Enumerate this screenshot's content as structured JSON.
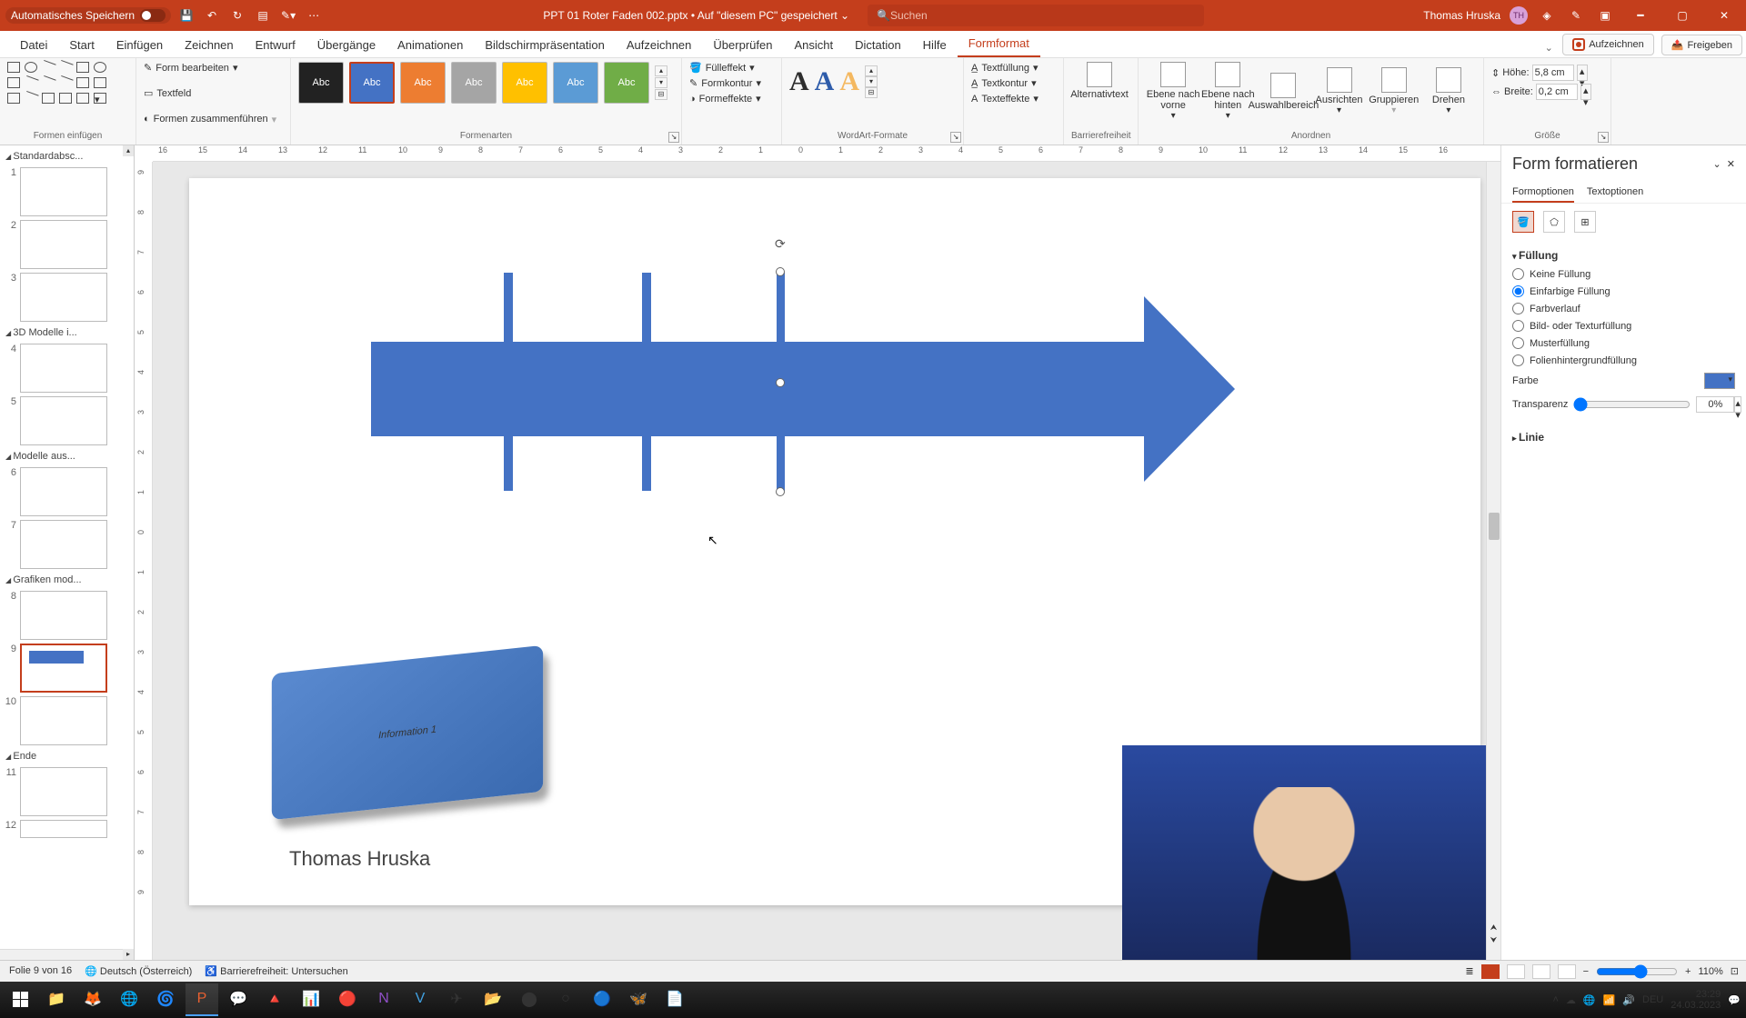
{
  "titlebar": {
    "autosave": "Automatisches Speichern",
    "doc": "PPT 01 Roter Faden 002.pptx • Auf \"diesem PC\" gespeichert ⌄",
    "search_ph": "Suchen",
    "user": "Thomas Hruska",
    "initials": "TH"
  },
  "tabs": {
    "file": "Datei",
    "start": "Start",
    "insert": "Einfügen",
    "draw": "Zeichnen",
    "design": "Entwurf",
    "trans": "Übergänge",
    "anim": "Animationen",
    "show": "Bildschirmpräsentation",
    "record_tab": "Aufzeichnen",
    "review": "Überprüfen",
    "view": "Ansicht",
    "dict": "Dictation",
    "help": "Hilfe",
    "format": "Formformat",
    "record": "Aufzeichnen",
    "share": "Freigeben"
  },
  "ribbon": {
    "g_insert": "Formen einfügen",
    "edit_shape": "Form bearbeiten",
    "textbox": "Textfeld",
    "merge": "Formen zusammenführen",
    "g_styles": "Formenarten",
    "sw": "Abc",
    "fill": "Fülleffekt",
    "outline": "Formkontur",
    "effects": "Formeffekte",
    "g_wordart": "WordArt-Formate",
    "textfill": "Textfüllung",
    "textoutline": "Textkontur",
    "texteffects": "Texteffekte",
    "g_access": "Barrierefreiheit",
    "alttext": "Alternativtext",
    "g_arrange": "Anordnen",
    "front": "Ebene nach vorne",
    "back": "Ebene nach hinten",
    "selpane": "Auswahlbereich",
    "align": "Ausrichten",
    "group": "Gruppieren",
    "rotate": "Drehen",
    "g_size": "Größe",
    "height": "Höhe:",
    "width": "Breite:",
    "h_val": "5,8 cm",
    "w_val": "0,2 cm"
  },
  "thumbs": {
    "sec1": "Standardabsc...",
    "sec2": "3D Modelle i...",
    "sec3": "Modelle aus...",
    "sec4": "Grafiken mod...",
    "sec5": "Ende",
    "n1": "1",
    "n2": "2",
    "n3": "3",
    "n4": "4",
    "n5": "5",
    "n6": "6",
    "n7": "7",
    "n8": "8",
    "n9": "9",
    "n10": "10",
    "n11": "11",
    "n12": "12"
  },
  "slide": {
    "info": "Information 1",
    "author": "Thomas Hruska"
  },
  "pane": {
    "title": "Form formatieren",
    "tab_shape": "Formoptionen",
    "tab_text": "Textoptionen",
    "sec_fill": "Füllung",
    "sec_line": "Linie",
    "r_none": "Keine Füllung",
    "r_solid": "Einfarbige Füllung",
    "r_grad": "Farbverlauf",
    "r_pic": "Bild- oder Texturfüllung",
    "r_patt": "Musterfüllung",
    "r_bg": "Folienhintergrundfüllung",
    "color": "Farbe",
    "trans": "Transparenz",
    "trans_val": "0%"
  },
  "status": {
    "slide": "Folie 9 von 16",
    "lang": "Deutsch (Österreich)",
    "access": "Barrierefreiheit: Untersuchen",
    "zoom": "110%"
  },
  "tray": {
    "kb": "DEU",
    "time": "23:29",
    "date": "24.03.2023"
  },
  "ruler": {
    "h": [
      "16",
      "15",
      "14",
      "13",
      "12",
      "11",
      "10",
      "9",
      "8",
      "7",
      "6",
      "5",
      "4",
      "3",
      "2",
      "1",
      "0",
      "1",
      "2",
      "3",
      "4",
      "5",
      "6",
      "7",
      "8",
      "9",
      "10",
      "11",
      "12",
      "13",
      "14",
      "15",
      "16"
    ],
    "v": [
      "9",
      "8",
      "7",
      "6",
      "5",
      "4",
      "3",
      "2",
      "1",
      "0",
      "1",
      "2",
      "3",
      "4",
      "5",
      "6",
      "7",
      "8",
      "9"
    ]
  }
}
